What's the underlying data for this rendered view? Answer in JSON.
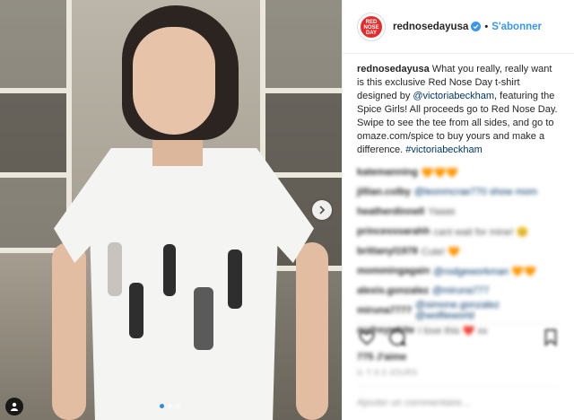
{
  "post": {
    "username": "rednosedayusa",
    "follow_label": "S'abonner",
    "separator": "•",
    "avatar_text": [
      "RED",
      "NOSE",
      "DAY"
    ],
    "caption": {
      "user": "rednosedayusa",
      "text1": " What you really, really want is this exclusive Red Nose Day t-shirt designed by ",
      "mention": "@victoriabeckham",
      "text2": ", featuring the Spice Girls! All proceeds go to Red Nose Day. Swipe to see the tee from all sides, and go to omaze.com/spice to buy yours and make a difference. ",
      "hashtag": "#victoriabeckham"
    },
    "comments": [
      {
        "user": "katemanning",
        "text": "🧡🧡🧡"
      },
      {
        "user": "jillian.colby",
        "text": "@leonmcrae770 show mom",
        "link": true
      },
      {
        "user": "heatherdinnell",
        "text": "Yaaas"
      },
      {
        "user": "princesssarahh",
        "text": "cant wait for mine! 😊"
      },
      {
        "user": "brittanyl1978",
        "text": "Cute! 🧡"
      },
      {
        "user": "mommingagain",
        "text": "@rodgeworkman 🧡🧡",
        "link": true
      },
      {
        "user": "alexis.gonzalez",
        "text": "@miruna777",
        "link": true
      },
      {
        "user": "miruna7777",
        "text": "@simone.gonzalez @wolfieworld",
        "link": true
      },
      {
        "user": "audreywhite",
        "text": "I love this ❤️ xx"
      }
    ],
    "likes": "775 J'aime",
    "time": "IL Y A 3 JOURS",
    "add_comment_placeholder": "Ajouter un commentaire..."
  },
  "colors": {
    "link_blue": "#3897f0",
    "mention_blue": "#003569",
    "brand_red": "#e62c2a"
  },
  "icons": [
    "verified-badge-icon",
    "next-arrow-icon",
    "tag-people-icon",
    "heart-icon",
    "comment-icon",
    "bookmark-icon"
  ],
  "carousel": {
    "total": 3,
    "active": 1
  }
}
